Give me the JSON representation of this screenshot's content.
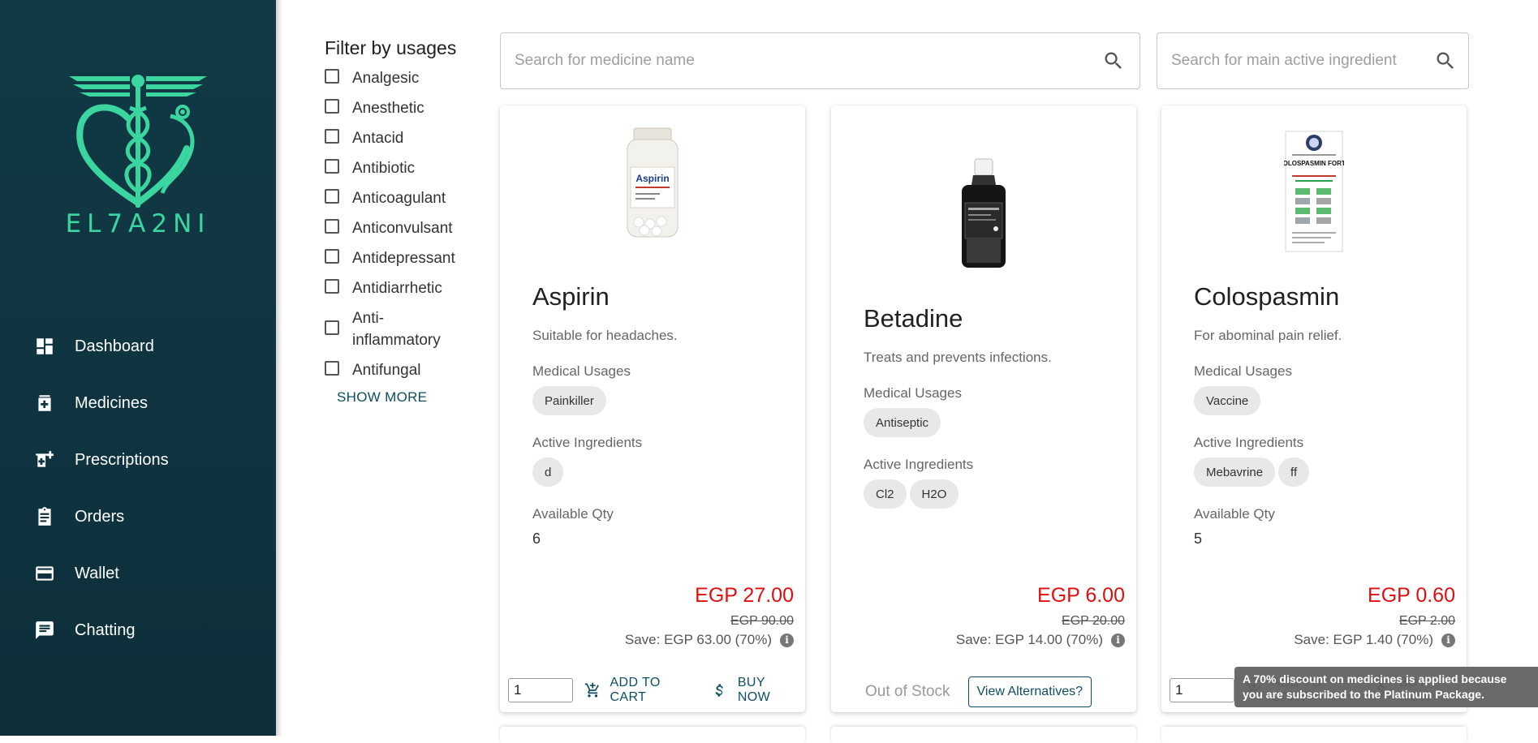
{
  "app": {
    "logo_text": "EL7A2NI"
  },
  "sidebar": {
    "items": [
      {
        "label": "Dashboard",
        "icon": "dashboard-icon"
      },
      {
        "label": "Medicines",
        "icon": "medicine-icon"
      },
      {
        "label": "Prescriptions",
        "icon": "prescription-icon"
      },
      {
        "label": "Orders",
        "icon": "orders-icon"
      },
      {
        "label": "Wallet",
        "icon": "wallet-icon"
      },
      {
        "label": "Chatting",
        "icon": "chat-icon"
      }
    ]
  },
  "filter": {
    "title": "Filter by usages",
    "options": [
      "Analgesic",
      "Anesthetic",
      "Antacid",
      "Antibiotic",
      "Anticoagulant",
      "Anticonvulsant",
      "Antidepressant",
      "Antidiarrhetic",
      "Anti-inflammatory",
      "Antifungal"
    ],
    "show_more": "SHOW MORE"
  },
  "search": {
    "name_placeholder": "Search for medicine name",
    "ingredient_placeholder": "Search for main active ingredient"
  },
  "labels": {
    "medical_usages": "Medical Usages",
    "active_ingredients": "Active Ingredients",
    "available_qty": "Available Qty",
    "add_to_cart": "ADD TO CART",
    "buy_now": "BUY NOW",
    "out_of_stock": "Out of Stock",
    "view_alternatives": "View Alternatives?"
  },
  "products": [
    {
      "name": "Aspirin",
      "description": "Suitable for headaches.",
      "usages": [
        "Painkiller"
      ],
      "ingredients": [
        "d"
      ],
      "available_qty": "6",
      "price": "EGP 27.00",
      "old_price": "EGP 90.00",
      "save": "Save: EGP 63.00 (70%)",
      "quantity_input": "1",
      "in_stock": true,
      "image_label": "Aspirin"
    },
    {
      "name": "Betadine",
      "description": "Treats and prevents infections.",
      "usages": [
        "Antiseptic"
      ],
      "ingredients": [
        "Cl2",
        "H2O"
      ],
      "price": "EGP 6.00",
      "old_price": "EGP 20.00",
      "save": "Save: EGP 14.00 (70%)",
      "in_stock": false
    },
    {
      "name": "Colospasmin",
      "description": "For abominal pain relief.",
      "usages": [
        "Vaccine"
      ],
      "ingredients": [
        "Mebavrine",
        "ff"
      ],
      "available_qty": "5",
      "price": "EGP 0.60",
      "old_price": "EGP 2.00",
      "save": "Save: EGP 1.40 (70%)",
      "quantity_input": "1",
      "in_stock": true,
      "image_label": "COLOSPASMIN FORTE"
    }
  ],
  "tooltip": {
    "text": "A 70% discount on medicines is applied because you are subscribed to the Platinum Package."
  },
  "colors": {
    "sidebar_bg": "#113a45",
    "logo_accent": "#3bd6a0",
    "price_red": "#e10f0f",
    "action_blue": "#0f4d63"
  }
}
